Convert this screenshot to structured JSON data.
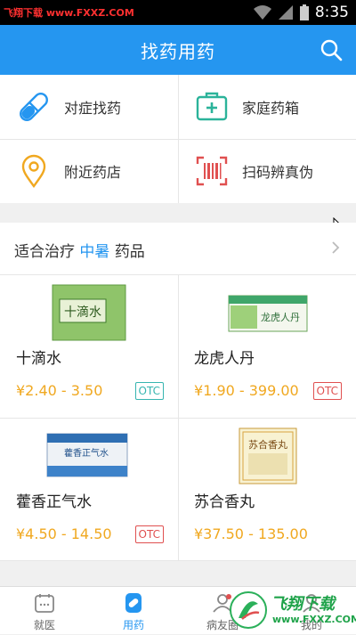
{
  "statusbar": {
    "watermark": "飞翔下载 www.FXXZ.COM",
    "time": "8:35"
  },
  "header": {
    "title": "找药用药"
  },
  "quick_actions": [
    {
      "label": "对症找药",
      "icon": "pill-icon"
    },
    {
      "label": "家庭药箱",
      "icon": "medicine-box-icon"
    },
    {
      "label": "附近药店",
      "icon": "location-pin-icon"
    },
    {
      "label": "扫码辨真伪",
      "icon": "barcode-scan-icon"
    }
  ],
  "section": {
    "prefix": "适合治疗",
    "keyword": "中暑",
    "suffix": "药品"
  },
  "products": [
    {
      "name": "十滴水",
      "price": "¥2.40 - 3.50",
      "badge": "OTC",
      "badge_color": "#36b5b0",
      "box_text": "十滴水"
    },
    {
      "name": "龙虎人丹",
      "price": "¥1.90 - 399.00",
      "badge": "OTC",
      "badge_color": "#e05050",
      "box_text": "龙虎人丹"
    },
    {
      "name": "藿香正气水",
      "price": "¥4.50 - 14.50",
      "badge": "OTC",
      "badge_color": "#e05050",
      "box_text": "藿香正气水"
    },
    {
      "name": "苏合香丸",
      "price": "¥37.50 - 135.00",
      "badge": "",
      "badge_color": "",
      "box_text": "苏合香丸"
    }
  ],
  "tabs": [
    {
      "label": "就医",
      "icon": "calendar-icon",
      "active": false
    },
    {
      "label": "用药",
      "icon": "pill-bottle-icon",
      "active": true
    },
    {
      "label": "病友圈",
      "icon": "community-icon",
      "active": false
    },
    {
      "label": "我的",
      "icon": "profile-icon",
      "active": false
    }
  ],
  "overlay": {
    "brand": "飞翔下载",
    "url": "www.FXXZ.COM"
  },
  "colors": {
    "accent": "#2596f0",
    "price": "#f0a820"
  }
}
